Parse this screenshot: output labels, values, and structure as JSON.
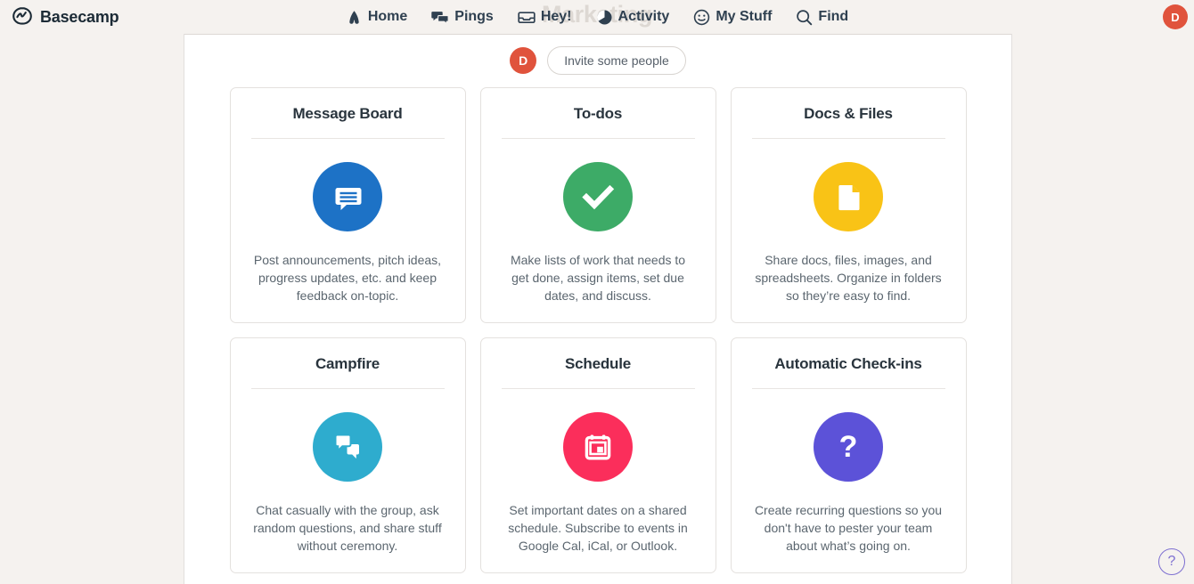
{
  "brand": {
    "name": "Basecamp",
    "logo_icon": "basecamp-logo-icon"
  },
  "project": {
    "ghost_title": "Marketing"
  },
  "nav": {
    "items": [
      {
        "label": "Home",
        "icon": "home-icon"
      },
      {
        "label": "Pings",
        "icon": "pings-icon"
      },
      {
        "label": "Hey!",
        "icon": "inbox-icon"
      },
      {
        "label": "Activity",
        "icon": "activity-pie-icon"
      },
      {
        "label": "My Stuff",
        "icon": "smiley-icon"
      },
      {
        "label": "Find",
        "icon": "search-icon"
      }
    ]
  },
  "account": {
    "avatar_initial": "D",
    "avatar_color": "#e0533c"
  },
  "invite": {
    "avatar_initial": "D",
    "button_label": "Invite some people"
  },
  "tools": [
    {
      "title": "Message Board",
      "description": "Post announcements, pitch ideas, progress updates, etc. and keep feedback on-topic.",
      "icon": "message-board-icon",
      "color": "#1d72c6"
    },
    {
      "title": "To-dos",
      "description": "Make lists of work that needs to get done, assign items, set due dates, and discuss.",
      "icon": "checkmark-icon",
      "color": "#3dab67"
    },
    {
      "title": "Docs & Files",
      "description": "Share docs, files, images, and spreadsheets. Organize in folders so they’re easy to find.",
      "icon": "document-icon",
      "color": "#f9c316"
    },
    {
      "title": "Campfire",
      "description": "Chat casually with the group, ask random questions, and share stuff without ceremony.",
      "icon": "chat-bubbles-icon",
      "color": "#2eacce"
    },
    {
      "title": "Schedule",
      "description": "Set important dates on a shared schedule. Subscribe to events in Google Cal, iCal, or Outlook.",
      "icon": "calendar-icon",
      "color": "#fb2e5b"
    },
    {
      "title": "Automatic Check-ins",
      "description": "Create recurring questions so you don't have to pester your team about what’s going on.",
      "icon": "question-mark-icon",
      "color": "#5c52d8"
    }
  ],
  "help": {
    "label": "?"
  }
}
